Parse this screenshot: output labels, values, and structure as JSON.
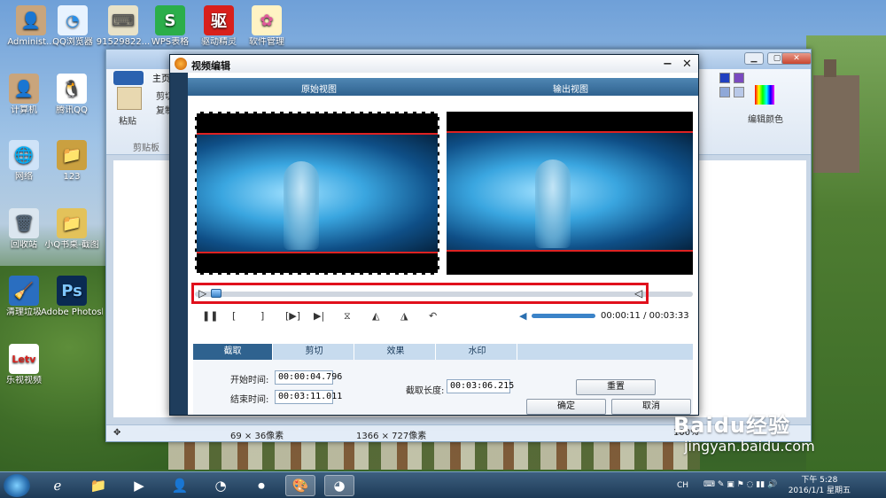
{
  "desktop": {
    "icons": [
      {
        "label": "Administ...",
        "glyph": "👤",
        "color": "#c9a57c"
      },
      {
        "label": "QQ浏览器",
        "glyph": "◔",
        "color": "#2b8fe8"
      },
      {
        "label": "91529822...",
        "glyph": "⌨",
        "color": "#e8e2c8"
      },
      {
        "label": "WPS表格",
        "glyph": "S",
        "color": "#2bae4a"
      },
      {
        "label": "驱动精灵",
        "glyph": "驱",
        "color": "#d8201c"
      },
      {
        "label": "软件管理",
        "glyph": "✿",
        "color": "#f2a31b"
      },
      {
        "label": "计算机",
        "glyph": "👤",
        "color": "#c9a57c"
      },
      {
        "label": "腾讯QQ",
        "glyph": "🐧",
        "color": "#222"
      },
      {
        "label": "网络",
        "glyph": "🌐",
        "color": "#2f7fd0"
      },
      {
        "label": "123",
        "glyph": "📁",
        "color": "#caa040"
      },
      {
        "label": "回收站",
        "glyph": "🗑",
        "color": "#9ab"
      },
      {
        "label": "小Q书桌-截图",
        "glyph": "📁",
        "color": "#e3c25a"
      },
      {
        "label": "清理垃圾",
        "glyph": "🧹",
        "color": "#2a6ec0"
      },
      {
        "label": "Adobe Photosh...",
        "glyph": "Ps",
        "color": "#0a2a52"
      },
      {
        "label": "乐视视频",
        "glyph": "Letv",
        "color": "#fff"
      }
    ]
  },
  "paint": {
    "home_tab": "主页",
    "clipboard_group": "剪贴板",
    "paste_label": "粘贴",
    "cut_label": "剪切",
    "copy_label": "复制",
    "edit_colors_label": "编辑颜色",
    "status_size": "69 × 36像素",
    "status_canvas": "1366 × 727像素",
    "status_zoom": "100%"
  },
  "dialog": {
    "title": "视频编辑",
    "close": "✕",
    "original_view": "原始视图",
    "output_view": "输出视图",
    "current_time": "00:00:11",
    "total_time": "00:03:33",
    "time_separator": " / ",
    "tabs": [
      "截取",
      "剪切",
      "效果",
      "水印"
    ],
    "start_label": "开始时间:",
    "start_value": "00:00:04.796",
    "end_label": "结束时间:",
    "end_value": "00:03:11.011",
    "length_label": "截取长度:",
    "length_value": "00:03:06.215",
    "reset_button": "重置",
    "ok_button": "确定",
    "cancel_button": "取消",
    "controls": [
      "pause",
      "mark-in",
      "mark-out",
      "play-selection",
      "step",
      "split",
      "rotate-left",
      "rotate-right",
      "undo"
    ]
  },
  "taskbar": {
    "language": "CH",
    "time": "下午 5:28",
    "date": "2016/1/1 星期五"
  },
  "watermark": {
    "brand": "Baidu经验",
    "url": "jingyan.baidu.com"
  },
  "colors": {
    "accent": "#2f628f",
    "selection": "#e0101c"
  }
}
